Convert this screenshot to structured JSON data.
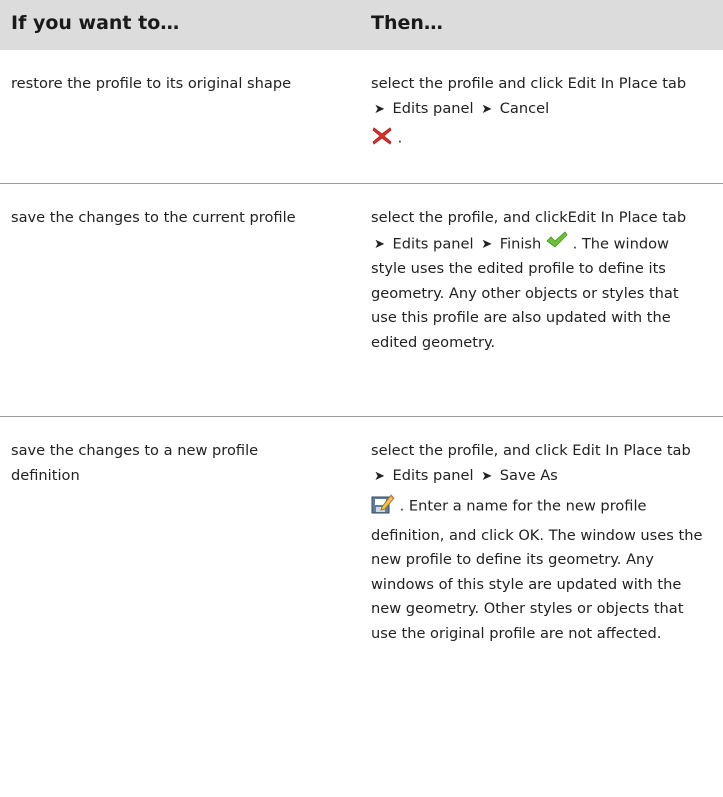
{
  "header": {
    "col1": "If you want to…",
    "col2": "Then…"
  },
  "rows": [
    {
      "if_text": "restore the profile to its original shape",
      "then_prefix": "select the profile and click Edit In Place tab",
      "then_panel": "Edits panel",
      "then_command": "Cancel",
      "then_suffix": ".",
      "icon": "cancel-x-icon"
    },
    {
      "if_text": "save the changes to the current profile",
      "then_prefix": "select the profile, and clickEdit In Place tab",
      "then_panel": "Edits panel",
      "then_command": "Finish",
      "then_suffix": ". The window style uses the edited profile to define its geometry. Any other objects or styles that use this profile are also updated with the edited geometry.",
      "icon": "finish-check-icon"
    },
    {
      "if_text": "save the changes to a new profile definition",
      "then_prefix": "select the profile, and click Edit In Place tab",
      "then_panel": "Edits panel",
      "then_command": "Save As",
      "then_suffix": ". Enter a name for the new profile definition, and click OK. The window uses the new profile to define its geometry. Any windows of this style are updated with the new geometry. Other styles or objects that use the original profile are not affected.",
      "icon": "save-as-icon"
    }
  ],
  "separator_glyph": "➤",
  "colors": {
    "header_bg": "#dcdcdc",
    "rule": "#9a9a9a",
    "cancel": "#d9332e",
    "check": "#6cbf3a"
  }
}
